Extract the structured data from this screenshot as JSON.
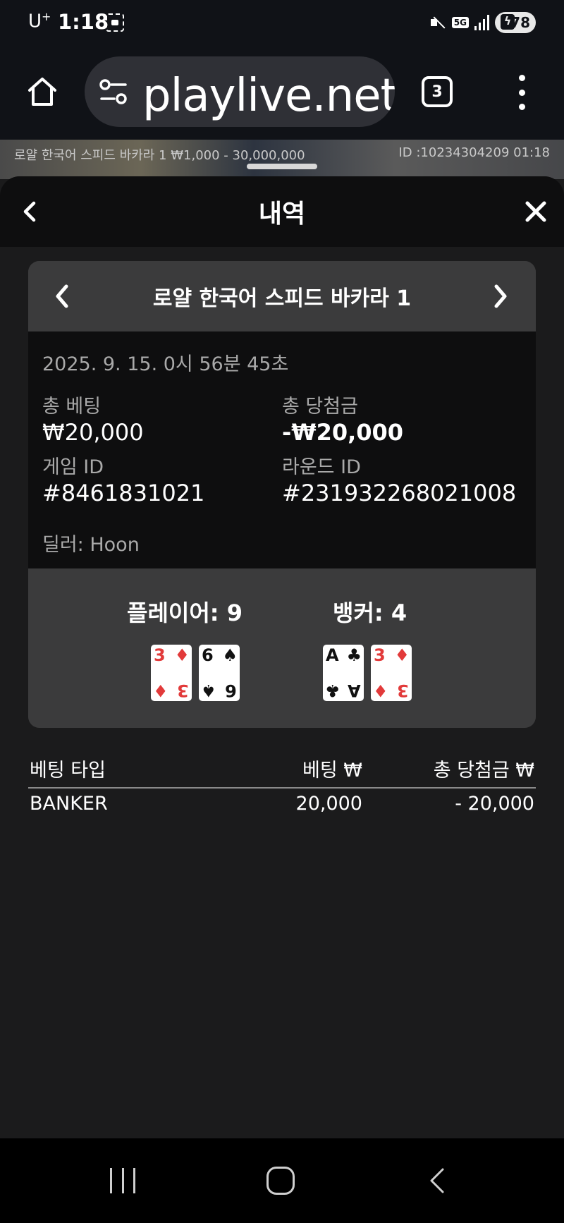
{
  "status_bar": {
    "carrier": "U",
    "carrier_sup": "+",
    "time": "1:18",
    "network": "5G",
    "battery": "78"
  },
  "browser": {
    "url": "playlive.net",
    "tab_count": "3"
  },
  "game_strip": {
    "info": "로얄 한국어 스피드 바카라 1 ₩1,000 - 30,000,000",
    "id": "ID :10234304209 01:18"
  },
  "modal": {
    "title": "내역"
  },
  "game": {
    "title": "로얄 한국어 스피드 바카라 1",
    "datetime": "2025. 9. 15. 0시 56분 45초",
    "total_bet_label": "총 베팅",
    "total_bet_value": "₩20,000",
    "total_win_label": "총 당첨금",
    "total_win_value": "-₩20,000",
    "game_id_label": "게임 ID",
    "game_id_value": "#8461831021",
    "round_id_label": "라운드 ID",
    "round_id_value": "#231932268021008",
    "dealer": "딜러: Hoon"
  },
  "hands": {
    "player_label": "플레이어: 9",
    "banker_label": "뱅커: 4",
    "player_cards": [
      {
        "rank": "3",
        "suit": "♦",
        "color": "#e23a3a"
      },
      {
        "rank": "6",
        "suit": "♠",
        "color": "#111111"
      }
    ],
    "banker_cards": [
      {
        "rank": "A",
        "suit": "♣",
        "color": "#111111"
      },
      {
        "rank": "3",
        "suit": "♦",
        "color": "#e23a3a"
      }
    ]
  },
  "bet_table": {
    "headers": [
      "베팅 타입",
      "베팅 ₩",
      "총 당첨금 ₩"
    ],
    "rows": [
      [
        "BANKER",
        "20,000",
        "- 20,000"
      ]
    ]
  }
}
